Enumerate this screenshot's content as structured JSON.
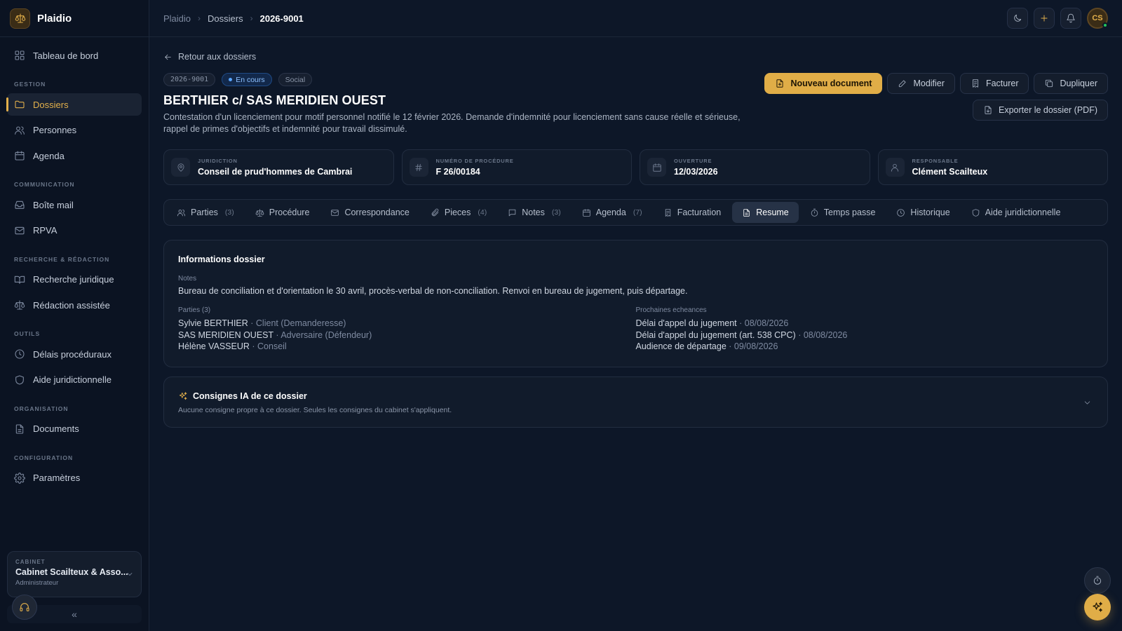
{
  "app": {
    "name": "Plaidio"
  },
  "sidebar": {
    "items": [
      {
        "label": "Tableau de bord",
        "icon": "dashboard-icon"
      }
    ],
    "sections": [
      {
        "title": "GESTION",
        "items": [
          {
            "label": "Dossiers",
            "icon": "folder-icon",
            "active": true
          },
          {
            "label": "Personnes",
            "icon": "users-icon"
          },
          {
            "label": "Agenda",
            "icon": "calendar-icon"
          }
        ]
      },
      {
        "title": "COMMUNICATION",
        "items": [
          {
            "label": "Boîte mail",
            "icon": "inbox-icon"
          },
          {
            "label": "RPVA",
            "icon": "mail-icon"
          }
        ]
      },
      {
        "title": "RECHERCHE & RÉDACTION",
        "items": [
          {
            "label": "Recherche juridique",
            "icon": "book-icon"
          },
          {
            "label": "Rédaction assistée",
            "icon": "scale-icon"
          }
        ]
      },
      {
        "title": "OUTILS",
        "items": [
          {
            "label": "Délais procéduraux",
            "icon": "clock-icon"
          },
          {
            "label": "Aide juridictionnelle",
            "icon": "shield-icon"
          }
        ]
      },
      {
        "title": "ORGANISATION",
        "items": [
          {
            "label": "Documents",
            "icon": "document-icon"
          }
        ]
      },
      {
        "title": "CONFIGURATION",
        "items": [
          {
            "label": "Paramètres",
            "icon": "gear-icon"
          }
        ]
      }
    ],
    "cabinet": {
      "label": "CABINET",
      "name": "Cabinet Scailteux & Asso...",
      "role": "Administrateur"
    },
    "collapse_label": "«"
  },
  "topbar": {
    "breadcrumb": [
      "Plaidio",
      "Dossiers",
      "2026-9001"
    ],
    "avatar_initials": "CS"
  },
  "dossier": {
    "back_label": "Retour aux dossiers",
    "badges": {
      "code": "2026-9001",
      "status": "En cours",
      "type": "Social"
    },
    "title": "BERTHIER c/ SAS MERIDIEN OUEST",
    "description": "Contestation d'un licenciement pour motif personnel notifié le 12 février 2026. Demande d'indemnité pour licenciement sans cause réelle et sérieuse, rappel de primes d'objectifs et indemnité pour travail dissimulé.",
    "actions": {
      "new_document": "Nouveau document",
      "edit": "Modifier",
      "invoice": "Facturer",
      "duplicate": "Dupliquer",
      "export": "Exporter le dossier (PDF)"
    },
    "info": [
      {
        "label": "JURIDICTION",
        "value": "Conseil de prud'hommes de Cambrai",
        "icon": "map-pin-icon"
      },
      {
        "label": "NUMÉRO DE PROCÉDURE",
        "value": "F 26/00184",
        "icon": "hash-icon"
      },
      {
        "label": "OUVERTURE",
        "value": "12/03/2026",
        "icon": "calendar-icon"
      },
      {
        "label": "RESPONSABLE",
        "value": "Clément Scailteux",
        "icon": "user-icon"
      }
    ],
    "tabs": [
      {
        "label": "Parties",
        "count": "(3)",
        "icon": "users-icon"
      },
      {
        "label": "Procédure",
        "count": "",
        "icon": "scale-icon"
      },
      {
        "label": "Correspondance",
        "count": "",
        "icon": "mail-icon"
      },
      {
        "label": "Pieces",
        "count": "(4)",
        "icon": "paperclip-icon"
      },
      {
        "label": "Notes",
        "count": "(3)",
        "icon": "message-icon"
      },
      {
        "label": "Agenda",
        "count": "(7)",
        "icon": "calendar-icon"
      },
      {
        "label": "Facturation",
        "count": "",
        "icon": "receipt-icon"
      },
      {
        "label": "Resume",
        "count": "",
        "icon": "document-icon",
        "active": true
      },
      {
        "label": "Temps passe",
        "count": "",
        "icon": "timer-icon"
      },
      {
        "label": "Historique",
        "count": "",
        "icon": "clock-icon"
      },
      {
        "label": "Aide juridictionnelle",
        "count": "",
        "icon": "shield-icon"
      }
    ],
    "summary": {
      "title": "Informations dossier",
      "notes_label": "Notes",
      "notes_text": "Bureau de conciliation et d'orientation le 30 avril, procès-verbal de non-conciliation. Renvoi en bureau de jugement, puis départage.",
      "parties_label": "Parties (3)",
      "parties": [
        {
          "name": "Sylvie BERTHIER",
          "role": " · Client (Demanderesse)"
        },
        {
          "name": "SAS MERIDIEN OUEST",
          "role": " · Adversaire (Défendeur)"
        },
        {
          "name": "Hélène VASSEUR",
          "role": " · Conseil"
        }
      ],
      "deadlines_label": "Prochaines echeances",
      "deadlines": [
        {
          "name": "Délai d'appel du jugement",
          "date": " · 08/08/2026"
        },
        {
          "name": "Délai d'appel du jugement (art. 538 CPC)",
          "date": " · 08/08/2026"
        },
        {
          "name": "Audience de départage",
          "date": " · 09/08/2026"
        }
      ]
    },
    "ai": {
      "title": "Consignes IA de ce dossier",
      "subtitle": "Aucune consigne propre à ce dossier. Seules les consignes du cabinet s'appliquent."
    }
  },
  "colors": {
    "background": "#0d1728",
    "sidebar": "#0b1322",
    "accent": "#e0ad47",
    "status_blue": "#5aa5ff"
  }
}
